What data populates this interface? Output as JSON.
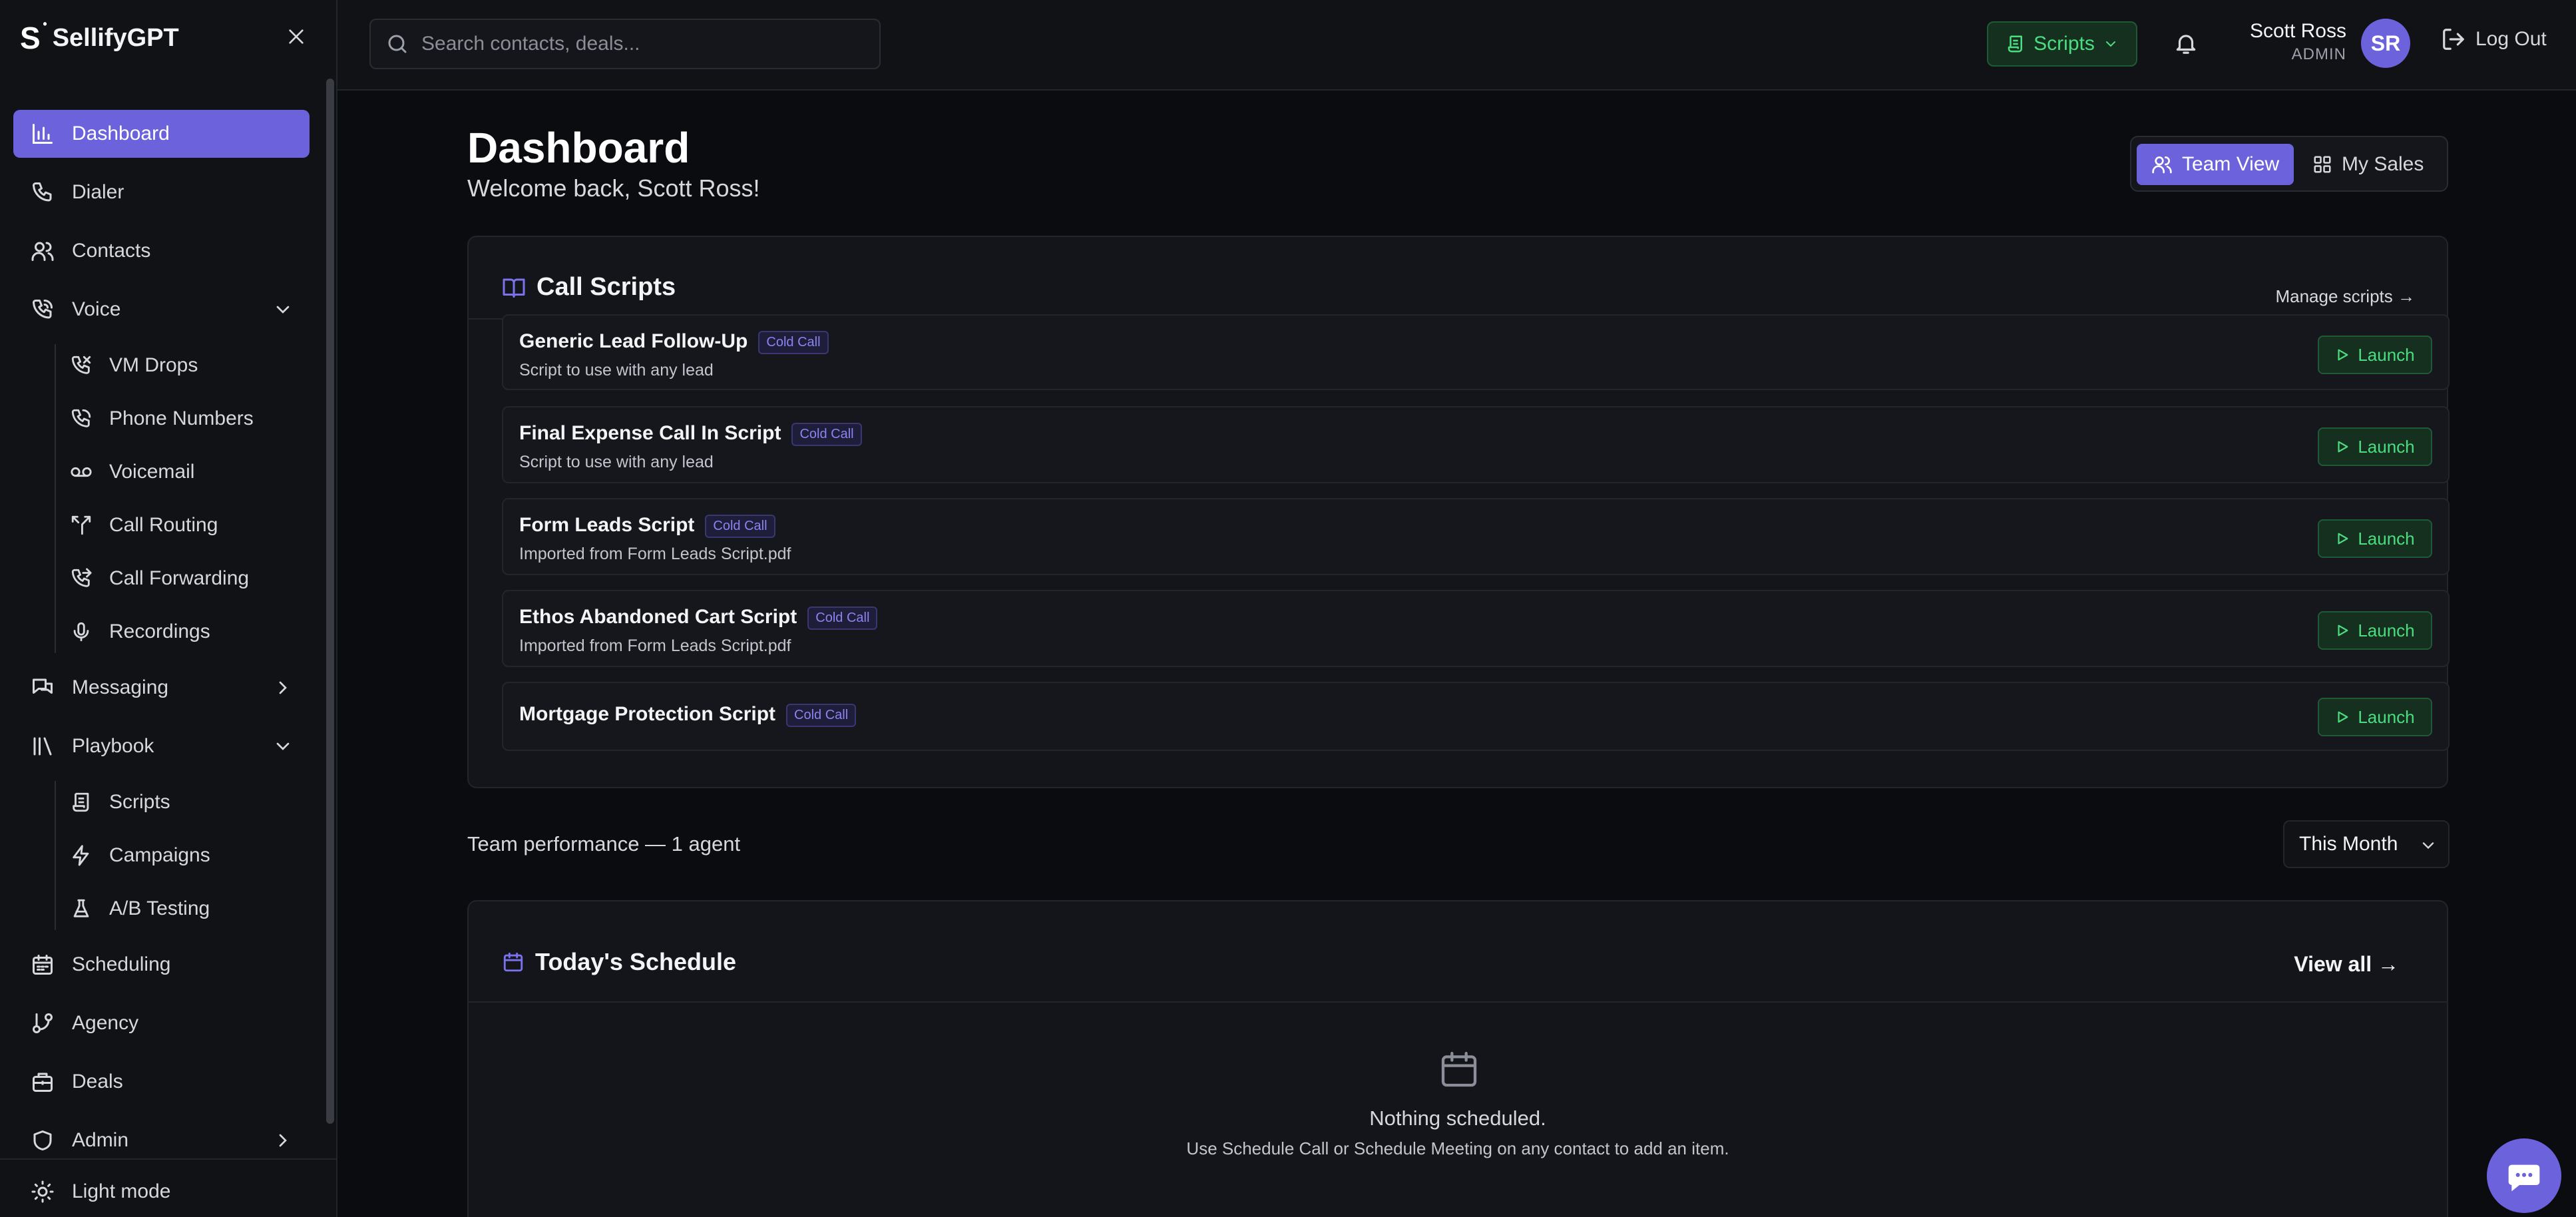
{
  "brand": {
    "logo_letter": "S",
    "logo_spark": "•",
    "name": "SellifyGPT"
  },
  "sidebar": {
    "items": {
      "dashboard": "Dashboard",
      "dialer": "Dialer",
      "contacts": "Contacts",
      "voice": "Voice",
      "messaging": "Messaging",
      "playbook": "Playbook",
      "scheduling": "Scheduling",
      "agency": "Agency",
      "deals": "Deals",
      "admin": "Admin"
    },
    "voice_sub": [
      "VM Drops",
      "Phone Numbers",
      "Voicemail",
      "Call Routing",
      "Call Forwarding",
      "Recordings"
    ],
    "playbook_sub": [
      "Scripts",
      "Campaigns",
      "A/B Testing"
    ],
    "light_mode": "Light mode"
  },
  "topbar": {
    "search_placeholder": "Search contacts, deals...",
    "scripts_label": "Scripts",
    "user_name": "Scott Ross",
    "user_role": "ADMIN",
    "avatar_initials": "SR",
    "logout_label": "Log Out"
  },
  "main": {
    "title": "Dashboard",
    "welcome": "Welcome back, Scott Ross!",
    "views": {
      "team": "Team View",
      "my_sales": "My Sales"
    },
    "call_scripts": {
      "title": "Call Scripts",
      "manage_link": "Manage scripts →",
      "launch_label": "Launch",
      "items": [
        {
          "name": "Generic Lead Follow-Up",
          "badge": "Cold Call",
          "desc": "Script to use with any lead"
        },
        {
          "name": "Final Expense Call In Script",
          "badge": "Cold Call",
          "desc": "Script to use with any lead"
        },
        {
          "name": "Form Leads Script",
          "badge": "Cold Call",
          "desc": "Imported from Form Leads Script.pdf"
        },
        {
          "name": "Ethos Abandoned Cart Script",
          "badge": "Cold Call",
          "desc": "Imported from Form Leads Script.pdf"
        },
        {
          "name": "Mortgage Protection Script",
          "badge": "Cold Call",
          "desc": ""
        }
      ]
    },
    "team_performance": "Team performance — 1 agent",
    "period": "This Month",
    "schedule": {
      "title": "Today's Schedule",
      "view_all": "View all →",
      "empty_title": "Nothing scheduled.",
      "empty_sub": "Use Schedule Call or Schedule Meeting on any contact to add an item."
    }
  },
  "colors": {
    "accent": "#6c63dc",
    "launch_green": "#4ade80",
    "background": "#0b0c10",
    "card": "#14151a"
  }
}
